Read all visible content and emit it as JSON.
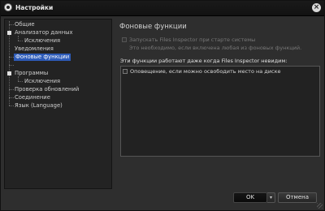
{
  "window": {
    "title": "Настройки",
    "close_glyph": "×"
  },
  "sidebar": {
    "items": [
      {
        "label": "Общие"
      },
      {
        "label": "Анализатор данных"
      },
      {
        "label": "Исключения"
      },
      {
        "label": "Уведомления"
      },
      {
        "label": "Фоновые функции",
        "selected": true
      },
      {
        "label": "Программы"
      },
      {
        "label": "Исключения"
      },
      {
        "label": "Проверка обновлений"
      },
      {
        "label": "Соединение"
      },
      {
        "label": "Язык (Language)"
      }
    ]
  },
  "main": {
    "title": "Фоновые функции",
    "startup_option": {
      "label": "Запускать Files Inspector при старте системы",
      "hint": "Это необходимо, если включена любая из фоновых функций.",
      "checked": false,
      "disabled": true
    },
    "section_label": "Эти функции работают даже когда Files Inspector невидим:",
    "list_items": [
      {
        "label": "Оповещение, если можно освободить место на диске",
        "checked": false
      }
    ]
  },
  "footer": {
    "ok_label": "OK",
    "dropdown_glyph": "▾",
    "cancel_label": "Отмена"
  },
  "colors": {
    "selection": "#2d5bb8",
    "background": "#2e2e2e"
  }
}
